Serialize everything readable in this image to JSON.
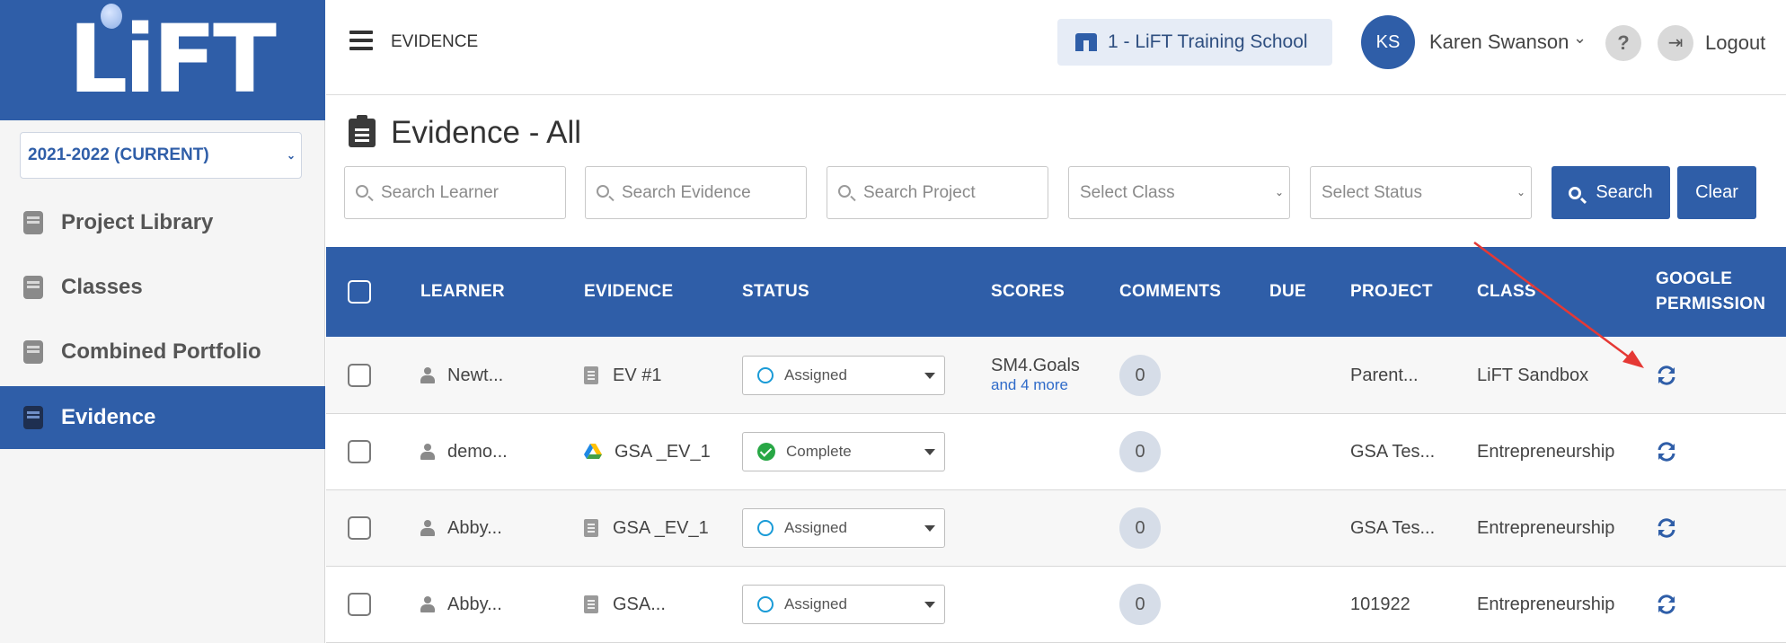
{
  "brand": {
    "logo_text": "LiFT",
    "primary": "#2f5ea8"
  },
  "sidebar": {
    "year": "2021-2022 (CURRENT)",
    "items": [
      {
        "label": "Project Library",
        "icon": "book-icon",
        "active": false
      },
      {
        "label": "Classes",
        "icon": "open-book-icon",
        "active": false
      },
      {
        "label": "Combined Portfolio",
        "icon": "book-icon",
        "active": false
      },
      {
        "label": "Evidence",
        "icon": "book-icon",
        "active": true
      }
    ]
  },
  "topbar": {
    "breadcrumb": "EVIDENCE",
    "school": "1 - LiFT Training School",
    "avatar_initials": "KS",
    "user_name": "Karen Swanson",
    "help": "?",
    "logout": "Logout"
  },
  "page": {
    "title": "Evidence - All",
    "filters": {
      "learner_placeholder": "Search Learner",
      "evidence_placeholder": "Search Evidence",
      "project_placeholder": "Search Project",
      "class_select": "Select Class",
      "status_select": "Select Status",
      "search_label": "Search",
      "clear_label": "Clear"
    }
  },
  "table": {
    "columns": [
      "LEARNER",
      "EVIDENCE",
      "STATUS",
      "SCORES",
      "COMMENTS",
      "DUE",
      "PROJECT",
      "CLASS",
      "GOOGLE",
      "PERMISSION"
    ],
    "rows": [
      {
        "learner": "Newt...",
        "evidence": "EV #1",
        "evidence_icon": "doc-icon",
        "status": "Assigned",
        "status_icon": "circle",
        "score": "SM4.Goals",
        "score_more": "and 4 more",
        "comments": "0",
        "due": "",
        "project": "Parent...",
        "class": "LiFT Sandbox"
      },
      {
        "learner": "demo...",
        "evidence": "GSA _EV_1",
        "evidence_icon": "google-drive-icon",
        "status": "Complete",
        "status_icon": "check",
        "score": "",
        "score_more": "",
        "comments": "0",
        "due": "",
        "project": "GSA Tes...",
        "class": "Entrepreneurship"
      },
      {
        "learner": "Abby...",
        "evidence": "GSA _EV_1",
        "evidence_icon": "doc-icon",
        "status": "Assigned",
        "status_icon": "circle",
        "score": "",
        "score_more": "",
        "comments": "0",
        "due": "",
        "project": "GSA Tes...",
        "class": "Entrepreneurship"
      },
      {
        "learner": "Abby...",
        "evidence": "GSA...",
        "evidence_icon": "doc-icon",
        "status": "Assigned",
        "status_icon": "circle",
        "score": "",
        "score_more": "",
        "comments": "0",
        "due": "",
        "project": "101922",
        "class": "Entrepreneurship"
      }
    ]
  },
  "annotation": {
    "arrow_color": "#e53935"
  }
}
